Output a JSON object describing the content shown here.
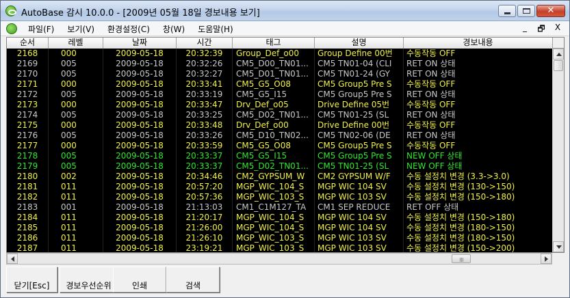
{
  "window": {
    "title": "AutoBase 감시 10.0.0 - [2009년 05월 18일 경보내용 보기]",
    "mdi_controls": [
      "_",
      "🗗",
      "X"
    ]
  },
  "menu": {
    "items": [
      "파일(F)",
      "보기(V)",
      "환경설정(C)",
      "창(W)",
      "도움말(H)"
    ]
  },
  "grid": {
    "columns": [
      "순서",
      "레벨",
      "날짜",
      "시간",
      "태그",
      "설명",
      "경보내용"
    ],
    "colors": {
      "white": "#c8c8c8",
      "yellow": "#f2f248",
      "green": "#2ee82e",
      "background": "#000000"
    },
    "rows": [
      {
        "seq": "2168",
        "level": "000",
        "date": "2009-05-18",
        "time": "20:32:39",
        "tag": "Group_Def_o00",
        "desc": "Group Define 00번",
        "msg": "수동작동 OFF",
        "color": "yellow"
      },
      {
        "seq": "2169",
        "level": "005",
        "date": "2009-05-18",
        "time": "20:32:26",
        "tag": "CM5_D00_TN01...",
        "desc": "CM5 TN01-04 (CLI",
        "msg": "RET ON 상태",
        "color": "white"
      },
      {
        "seq": "2170",
        "level": "005",
        "date": "2009-05-18",
        "time": "20:32:27",
        "tag": "CM5_D01_TN01...",
        "desc": "CM5 TN01-24 (GY",
        "msg": "RET ON 상태",
        "color": "white"
      },
      {
        "seq": "2171",
        "level": "000",
        "date": "2009-05-18",
        "time": "20:33:41",
        "tag": "CM5_G5_O08",
        "desc": "CM5 Group5 Pre S",
        "msg": "수동작동 OFF",
        "color": "yellow"
      },
      {
        "seq": "2172",
        "level": "005",
        "date": "2009-05-18",
        "time": "20:33:19",
        "tag": "CM5_G5_I15",
        "desc": "CM5 Group5 Pre S",
        "msg": "RET ON 상태",
        "color": "white"
      },
      {
        "seq": "2173",
        "level": "000",
        "date": "2009-05-18",
        "time": "20:33:47",
        "tag": "Drv_Def_o05",
        "desc": "Drive Define 05번",
        "msg": "수동작동 OFF",
        "color": "yellow"
      },
      {
        "seq": "2174",
        "level": "005",
        "date": "2009-05-18",
        "time": "20:33:25",
        "tag": "CM5_D02_TN01...",
        "desc": "CM5 TN01-25 (SL",
        "msg": "RET ON 상태",
        "color": "white"
      },
      {
        "seq": "2175",
        "level": "000",
        "date": "2009-05-18",
        "time": "20:33:48",
        "tag": "Drv_Def_o00",
        "desc": "Drive Define 00번",
        "msg": "수동작동 OFF",
        "color": "yellow"
      },
      {
        "seq": "2176",
        "level": "005",
        "date": "2009-05-18",
        "time": "20:33:26",
        "tag": "CM5_D10_TN02...",
        "desc": "CM5 TN02-06 (DE",
        "msg": "RET ON 상태",
        "color": "white"
      },
      {
        "seq": "2177",
        "level": "000",
        "date": "2009-05-18",
        "time": "20:33:59",
        "tag": "CM5_G5_O08",
        "desc": "CM5 Group5 Pre S",
        "msg": "수동작동 OFF",
        "color": "yellow"
      },
      {
        "seq": "2178",
        "level": "005",
        "date": "2009-05-18",
        "time": "20:33:37",
        "tag": "CM5_G5_I15",
        "desc": "CM5 Group5 Pre S",
        "msg": "NEW OFF 상태",
        "color": "green"
      },
      {
        "seq": "2179",
        "level": "005",
        "date": "2009-05-18",
        "time": "20:33:37",
        "tag": "CM5_D02_TN01...",
        "desc": "CM5 TN01-25 (SL",
        "msg": "NEW OFF 상태",
        "color": "green"
      },
      {
        "seq": "2180",
        "level": "002",
        "date": "2009-05-18",
        "time": "20:34:46",
        "tag": "CM2_GYPSUM_W",
        "desc": "CM2 GYPSUM W/F",
        "msg": "수동 설정치 변경 (3.3->3.0)",
        "color": "yellow"
      },
      {
        "seq": "2181",
        "level": "011",
        "date": "2009-05-18",
        "time": "20:57:20",
        "tag": "MGP_WIC_104_S",
        "desc": "MGP WIC 104 SV",
        "msg": "수동 설정치 변경 (130->150)",
        "color": "yellow"
      },
      {
        "seq": "2182",
        "level": "011",
        "date": "2009-05-18",
        "time": "20:57:36",
        "tag": "MGP_WIC_103_S",
        "desc": "MGP WIC 103 SV",
        "msg": "수동 설정치 변경 (150->180)",
        "color": "yellow"
      },
      {
        "seq": "2183",
        "level": "001",
        "date": "2009-05-18",
        "time": "21:13:03",
        "tag": "CM1_C1M127_TA",
        "desc": "CM1 SEP REDUCE",
        "msg": "RET OFF 상태",
        "color": "white"
      },
      {
        "seq": "2184",
        "level": "011",
        "date": "2009-05-18",
        "time": "21:20:17",
        "tag": "MGP_WIC_104_S",
        "desc": "MGP WIC 104 SV",
        "msg": "수동 설정치 변경 (150->180)",
        "color": "yellow"
      },
      {
        "seq": "2185",
        "level": "011",
        "date": "2009-05-18",
        "time": "21:26:00",
        "tag": "MGP_WIC_104_S",
        "desc": "MGP WIC 104 SV",
        "msg": "수동 설정치 변경 (180->150)",
        "color": "yellow"
      },
      {
        "seq": "2186",
        "level": "011",
        "date": "2009-05-18",
        "time": "21:26:10",
        "tag": "MGP_WIC_103_S",
        "desc": "MGP WIC 103 SV",
        "msg": "수동 설정치 변경 (180->150)",
        "color": "yellow"
      },
      {
        "seq": "2187",
        "level": "011",
        "date": "2009-05-18",
        "time": "23:19:21",
        "tag": "MGP_WIC_103_S",
        "desc": "MGP WIC 103 SV",
        "msg": "수동 설정치 변경 (150->200)",
        "color": "yellow"
      }
    ]
  },
  "toolbar": {
    "buttons": [
      "닫기[Esc]",
      "경보우선순위",
      "인쇄",
      "검색"
    ]
  }
}
